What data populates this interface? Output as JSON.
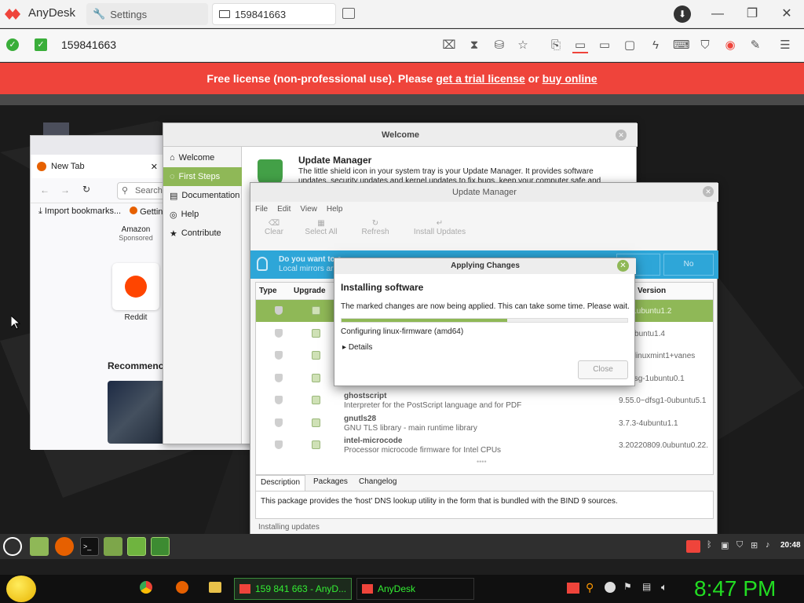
{
  "anydesk": {
    "brand": "AnyDesk",
    "settings_tab": "Settings",
    "remote_tab": "159841663",
    "address": "159841663",
    "banner": {
      "prefix": "Free license (non-professional use). Please ",
      "trial_link": "get a trial license",
      "or": " or ",
      "buy_link": "buy online"
    },
    "colors": {
      "brand": "#ef443b",
      "ok": "#3aae3a"
    }
  },
  "firefox": {
    "tab_label": "New Tab",
    "search_placeholder": "Search",
    "bookmarks": [
      "Import bookmarks...",
      "Getting"
    ],
    "shortcuts": [
      {
        "name": "Amazon",
        "sub": "Sponsored"
      },
      {
        "name": "Reddit"
      }
    ],
    "recommended": "Recommenc"
  },
  "welcome": {
    "title": "Welcome",
    "sidebar": [
      "Welcome",
      "First Steps",
      "Documentation",
      "Help",
      "Contribute"
    ],
    "heading": "Update Manager",
    "body_line1": "The little shield icon in your system tray is your Update Manager. It provides software",
    "body_line2": "updates, security updates and kernel updates to fix bugs, keep your computer safe and"
  },
  "update_manager": {
    "title": "Update Manager",
    "menu": [
      "File",
      "Edit",
      "View",
      "Help"
    ],
    "tools": [
      "Clear",
      "Select All",
      "Refresh",
      "Install Updates"
    ],
    "info_line1": "Do you want to s",
    "info_line2": "Local mirrors ar",
    "info_no": "No",
    "columns": [
      "Type",
      "Upgrade",
      "Version"
    ],
    "rows": [
      {
        "name": "",
        "desc": "",
        "version": "1.1-1ubuntu1.2",
        "selected": true
      },
      {
        "name": "",
        "desc": "",
        "version": "0-1ubuntu1.4",
        "selected": false
      },
      {
        "name": "",
        "desc": "",
        "version": "0.3+linuxmint1+vanes",
        "selected": false
      },
      {
        "name": "",
        "desc": "",
        "version": "8+dfsg-1ubuntu0.1",
        "selected": false
      },
      {
        "name": "ghostscript",
        "desc": "Interpreter for the PostScript language and for PDF",
        "version": "9.55.0~dfsg1-0ubuntu5.1",
        "selected": false
      },
      {
        "name": "gnutls28",
        "desc": "GNU TLS library - main runtime library",
        "version": "3.7.3-4ubuntu1.1",
        "selected": false
      },
      {
        "name": "intel-microcode",
        "desc": "Processor microcode firmware for Intel CPUs",
        "version": "3.20220809.0ubuntu0.22.",
        "selected": false
      }
    ],
    "tabs": [
      "Description",
      "Packages",
      "Changelog"
    ],
    "description": "This package provides the 'host' DNS lookup utility in the form that is bundled with the BIND 9 sources.",
    "status": "Installing updates"
  },
  "dialog": {
    "title": "Applying Changes",
    "heading": "Installing software",
    "message": "The marked changes are now being applied. This can take some time. Please wait.",
    "progress": 0.58,
    "status": "Configuring linux-firmware (amd64)",
    "details": "Details",
    "close": "Close"
  },
  "mint_panel": {
    "time": "20:48"
  },
  "host_taskbar": {
    "tasks": [
      "159 841 663 - AnyD...",
      "AnyDesk"
    ],
    "clock": "8:47 PM"
  }
}
